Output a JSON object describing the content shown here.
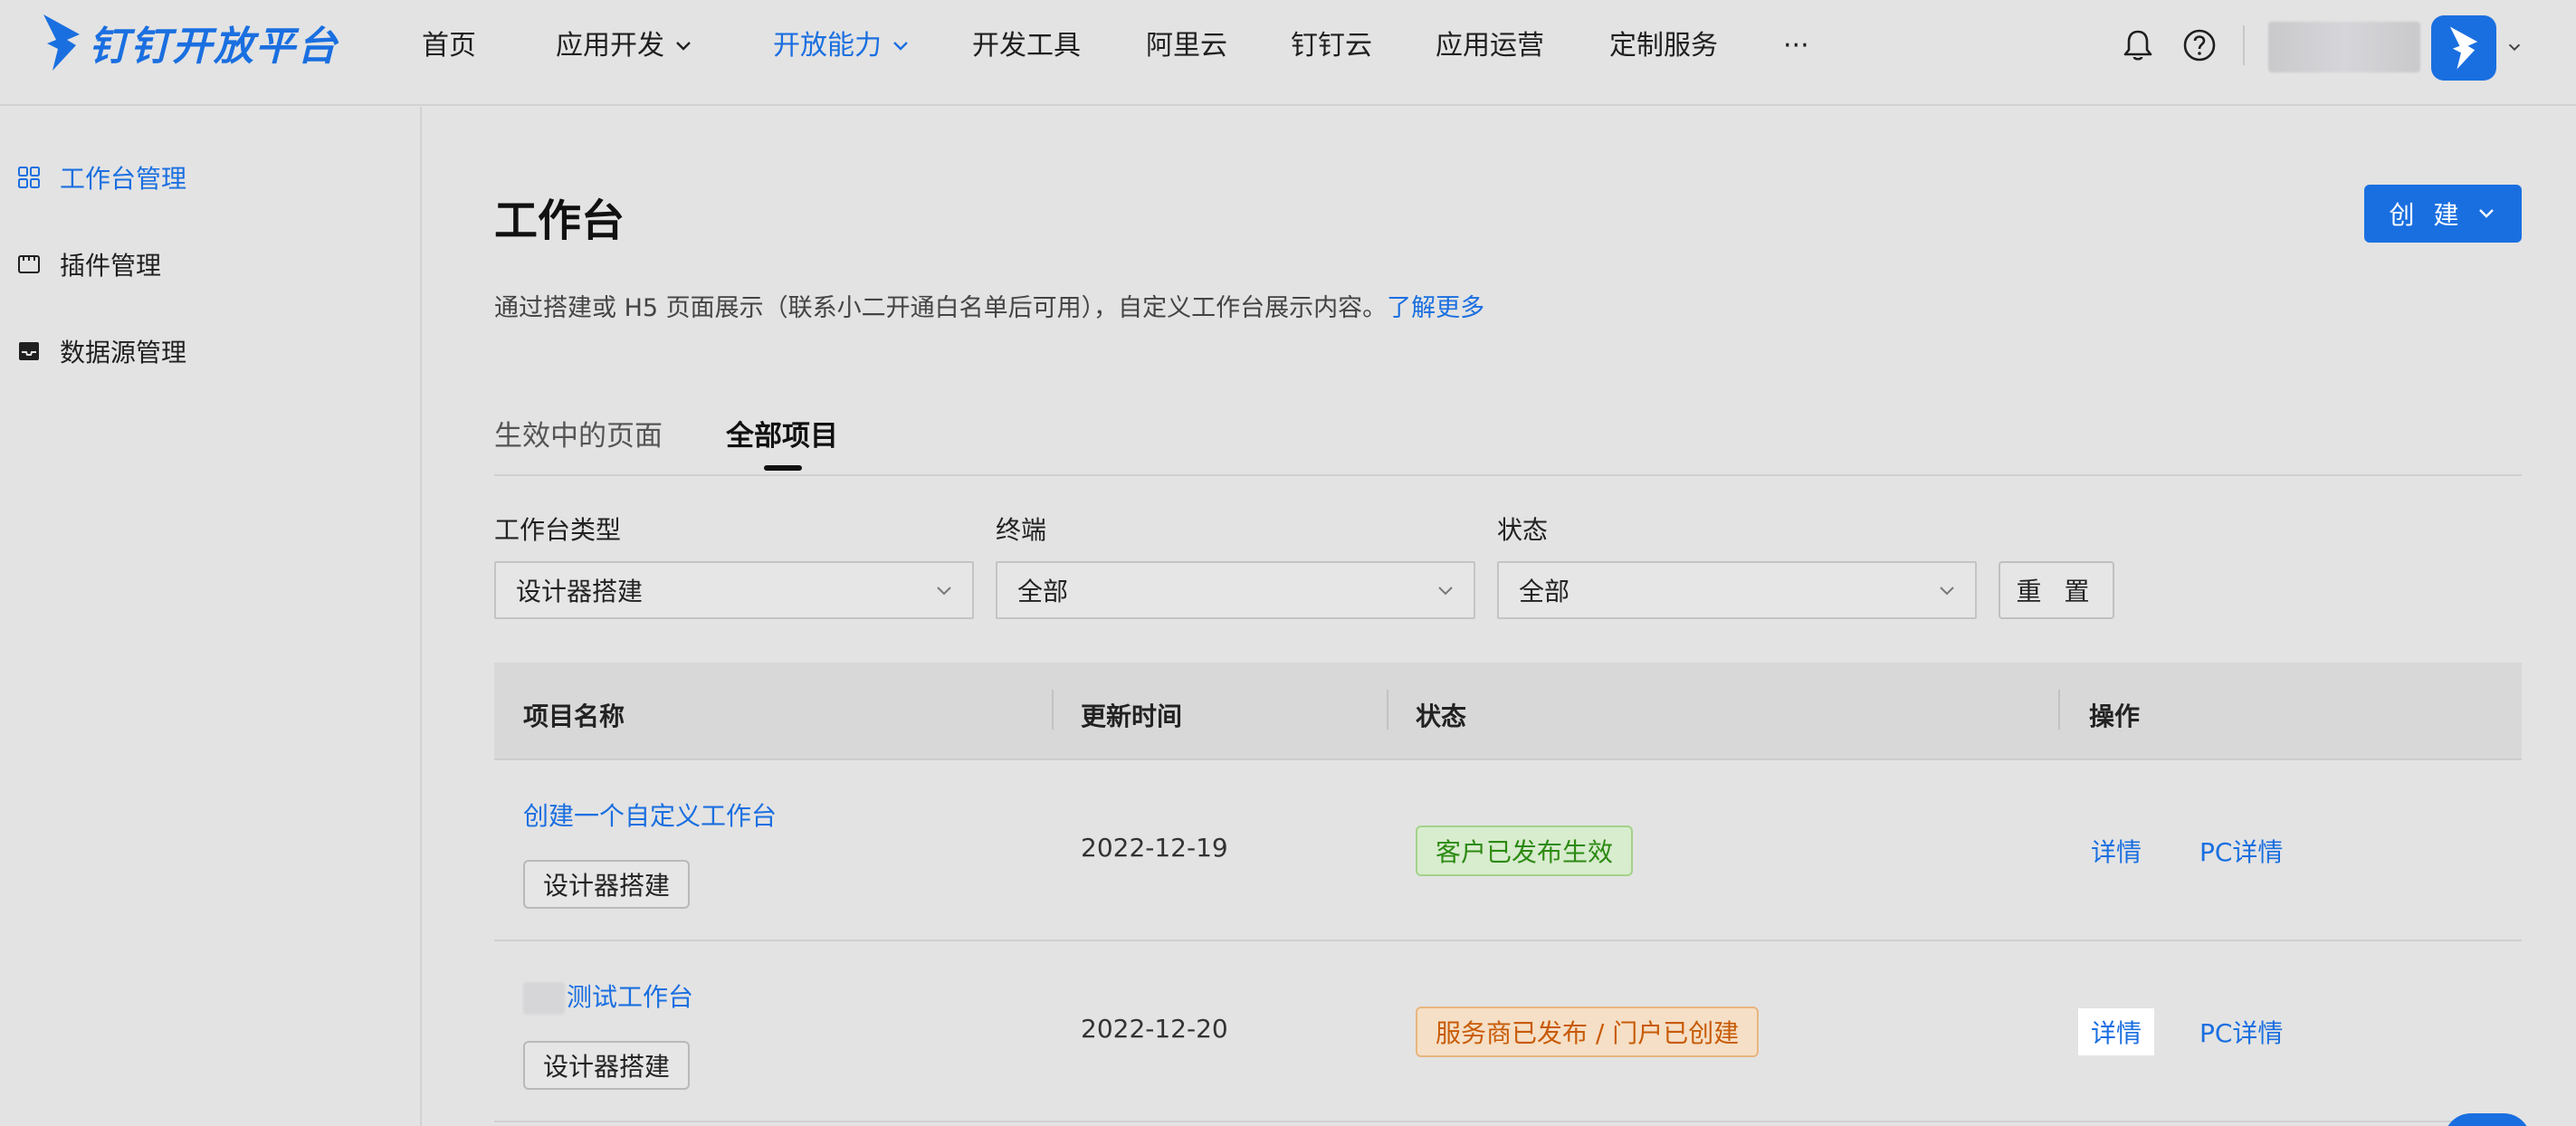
{
  "brand": {
    "name": "钉钉开放平台",
    "color": "#1a6fe0"
  },
  "nav": {
    "items": [
      {
        "label": "首页"
      },
      {
        "label": "应用开发"
      },
      {
        "label": "开放能力"
      },
      {
        "label": "开发工具"
      },
      {
        "label": "阿里云"
      },
      {
        "label": "钉钉云"
      },
      {
        "label": "应用运营"
      },
      {
        "label": "定制服务"
      },
      {
        "label": "···"
      }
    ],
    "icons": [
      "bell-icon",
      "help-icon"
    ]
  },
  "sidebar": {
    "items": [
      {
        "label": "工作台管理",
        "icon": "grid-icon"
      },
      {
        "label": "插件管理",
        "icon": "plugin-icon"
      },
      {
        "label": "数据源管理",
        "icon": "inbox-icon"
      }
    ]
  },
  "main": {
    "title": "工作台",
    "description": "通过搭建或 H5 页面展示（联系小二开通白名单后可用），自定义工作台展示内容。",
    "learn_more": "了解更多",
    "create_label": "创 建",
    "tabs": [
      {
        "label": "生效中的页面"
      },
      {
        "label": "全部项目"
      }
    ],
    "filters": {
      "type": {
        "label": "工作台类型",
        "value": "设计器搭建"
      },
      "terminal": {
        "label": "终端",
        "value": "全部"
      },
      "status": {
        "label": "状态",
        "value": "全部"
      },
      "reset_label": "重 置"
    },
    "table": {
      "headers": [
        "项目名称",
        "更新时间",
        "状态",
        "操作"
      ],
      "rows": [
        {
          "name": "创建一个自定义工作台",
          "type_tag": "设计器搭建",
          "date": "2022-12-19",
          "status": "客户已发布生效",
          "actions": [
            "详情",
            "PC详情"
          ]
        },
        {
          "name": "测试工作台",
          "type_tag": "设计器搭建",
          "date": "2022-12-20",
          "status": "服务商已发布 / 门户已创建",
          "actions": [
            "详情",
            "PC详情"
          ]
        }
      ]
    }
  },
  "colors": {
    "status_green": "#2c8a12",
    "status_orange": "#c85a06",
    "link": "#1a6fe0"
  }
}
